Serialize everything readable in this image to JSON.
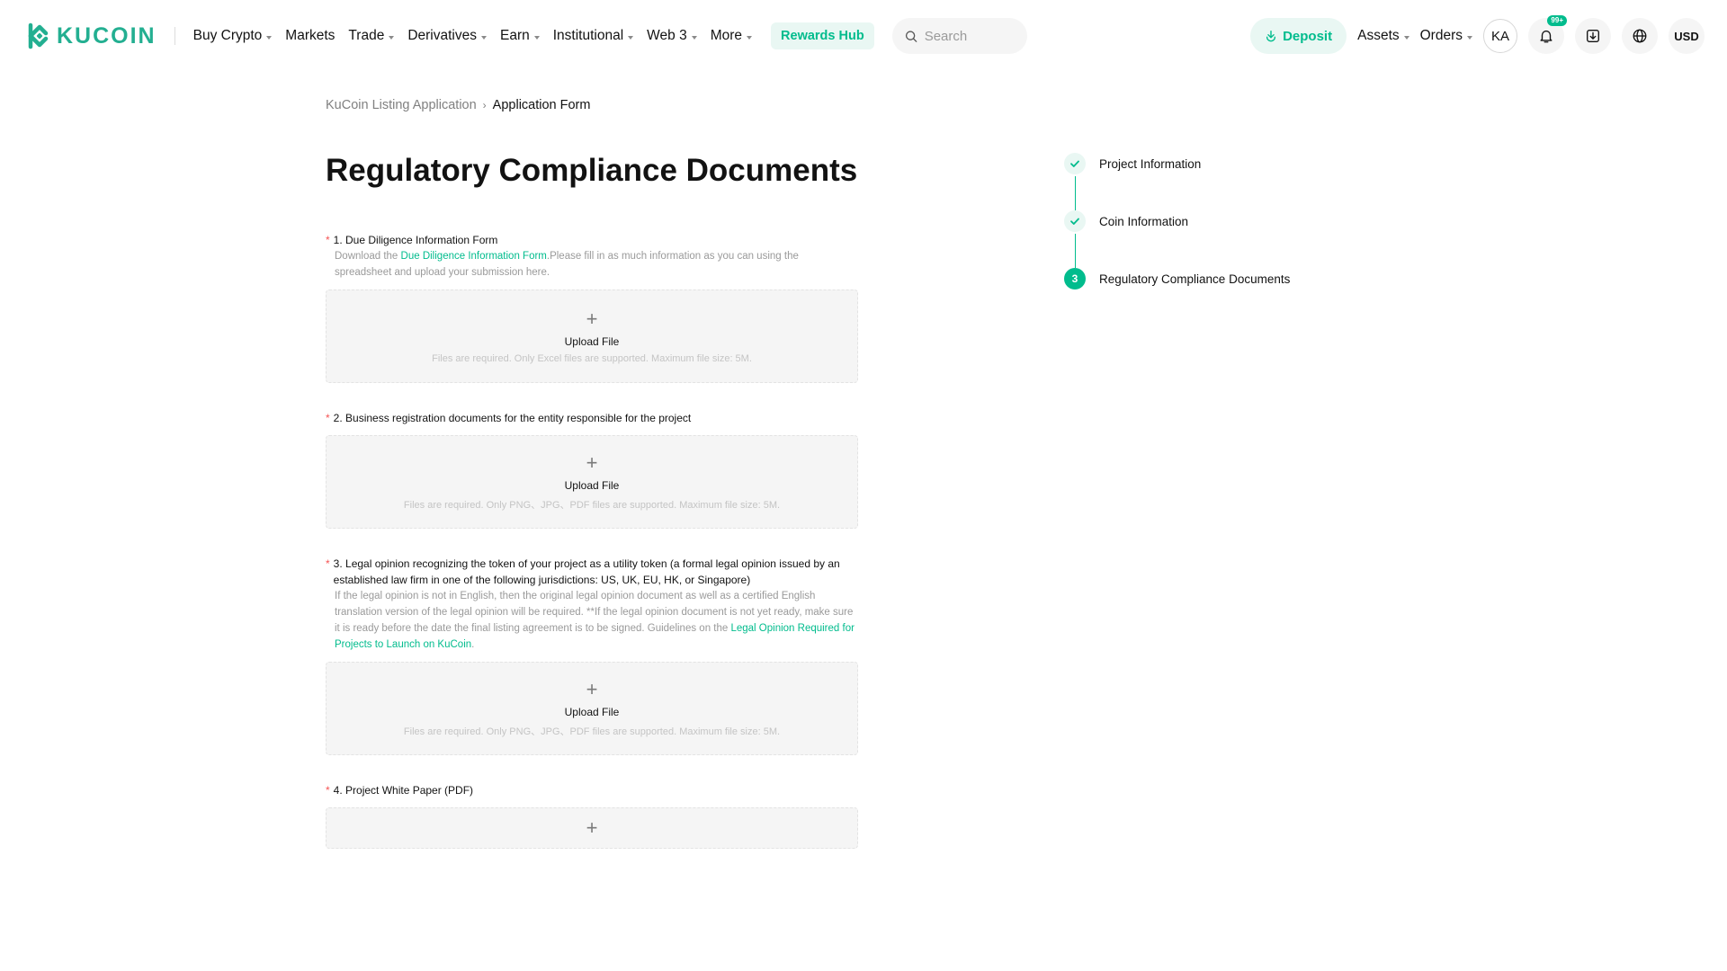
{
  "brand": {
    "name": "KUCOIN",
    "color": "#23AF91"
  },
  "nav": [
    {
      "label": "Buy Crypto",
      "dropdown": true
    },
    {
      "label": "Markets",
      "dropdown": false
    },
    {
      "label": "Trade",
      "dropdown": true
    },
    {
      "label": "Derivatives",
      "dropdown": true
    },
    {
      "label": "Earn",
      "dropdown": true
    },
    {
      "label": "Institutional",
      "dropdown": true
    },
    {
      "label": "Web 3",
      "dropdown": true
    },
    {
      "label": "More",
      "dropdown": true
    }
  ],
  "rewards_hub": "Rewards Hub",
  "search": {
    "placeholder": "Search"
  },
  "header_right": {
    "deposit": "Deposit",
    "assets": "Assets",
    "orders": "Orders",
    "avatar": "KA",
    "notifications_badge": "99+",
    "currency": "USD"
  },
  "breadcrumb": {
    "parent": "KuCoin Listing Application",
    "current": "Application Form"
  },
  "page_title": "Regulatory Compliance Documents",
  "fields": [
    {
      "label": "1. Due Diligence Information Form",
      "desc_prefix": "Download the ",
      "desc_link": "Due Diligence Information Form",
      "desc_suffix": ".Please fill in as much information as you can using the spreadsheet and upload your submission here.",
      "upload_text": "Upload File",
      "upload_hint": "Files are required. Only Excel files are supported. Maximum file size: 5M."
    },
    {
      "label": "2. Business registration documents for the entity responsible for the project",
      "upload_text": "Upload File",
      "upload_hint": "Files are required. Only PNG、JPG、PDF files are supported. Maximum file size: 5M."
    },
    {
      "label": "3. Legal opinion recognizing the token of your project as a utility token (a formal legal opinion issued by an established law firm in one of the following jurisdictions: US, UK, EU, HK, or Singapore)",
      "desc_prefix": "If the legal opinion is not in English, then the original legal opinion document as well as a certified English translation version of the legal opinion will be required. **If the legal opinion document is not yet ready, make sure it is ready before the date the final listing agreement is to be signed. Guidelines on the ",
      "desc_link": "Legal Opinion Required for Projects to Launch on KuCoin",
      "desc_suffix": ".",
      "upload_text": "Upload File",
      "upload_hint": "Files are required. Only PNG、JPG、PDF files are supported. Maximum file size: 5M."
    },
    {
      "label": "4. Project White Paper (PDF)"
    }
  ],
  "steps": [
    {
      "label": "Project Information",
      "status": "done"
    },
    {
      "label": "Coin Information",
      "status": "done"
    },
    {
      "label": "Regulatory Compliance Documents",
      "status": "active",
      "number": "3"
    }
  ],
  "colors": {
    "accent": "#01BC8D",
    "required": "#F65454"
  },
  "icons": {
    "plus": "+",
    "chevron": "›"
  }
}
